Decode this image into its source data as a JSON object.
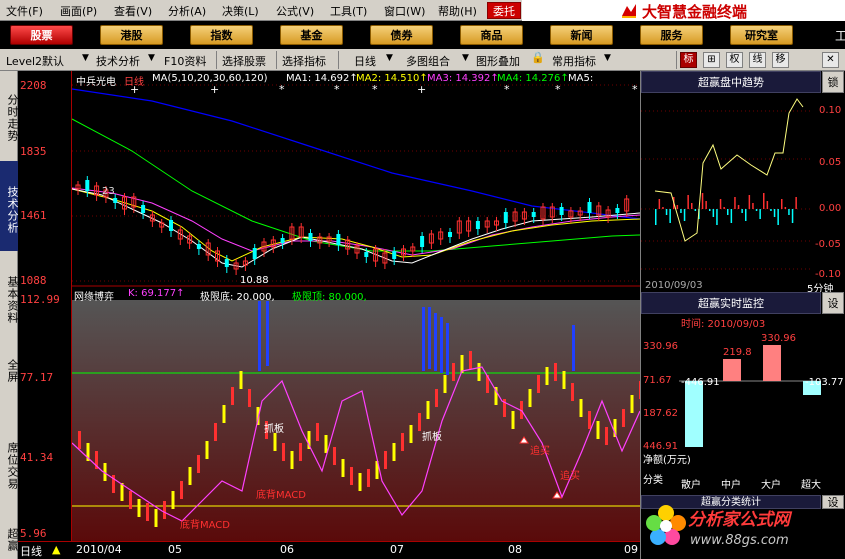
{
  "menu": {
    "items": [
      "文件(F)",
      "画面(P)",
      "查看(V)",
      "分析(A)",
      "决策(L)",
      "公式(V)",
      "工具(T)",
      "窗口(W)",
      "帮助(H)"
    ],
    "trade_btn": "委托",
    "brand": "大智慧金融终端"
  },
  "categories": [
    {
      "label": "股票",
      "active": true
    },
    {
      "label": "港股"
    },
    {
      "label": "指数"
    },
    {
      "label": "基金"
    },
    {
      "label": "债券"
    },
    {
      "label": "商品"
    },
    {
      "label": "新闻"
    },
    {
      "label": "服务"
    },
    {
      "label": "研究室"
    }
  ],
  "cat_extra": "工",
  "toolbar": {
    "level2": "Level2默认",
    "tech": "技术分析",
    "f10": "F10资料",
    "select_stock": "选择股票",
    "select_indicator": "选择指标",
    "period": "日线",
    "multi": "多图组合",
    "overlay": "图形叠加",
    "common": "常用指标",
    "squares": [
      "标",
      "⊞",
      "权",
      "线",
      "移",
      "✕"
    ]
  },
  "left_tabs": [
    "分时走势",
    "技术分析",
    "基本资料",
    "全屏",
    "席位交易",
    "超赢"
  ],
  "main_chart": {
    "stock_name": "中兵光电",
    "period": "日线",
    "ma_label": "MA(5,10,20,30,60,120)",
    "ma1": "MA1: 14.692↑",
    "ma2": "MA2: 14.510↑",
    "ma3": "MA3: 14.392↑",
    "ma4": "MA4: 14.276↑",
    "ma5": "MA5:",
    "y_labels": [
      "2208",
      "1835",
      "1461",
      "1088"
    ],
    "low_label": "10.88",
    "high_label": "23"
  },
  "indicator": {
    "name": "网缘博弈",
    "k": "K: 69.177↑",
    "low_limit": "极限底: 20.000,",
    "high_limit": "极限顶: 80.000,",
    "y_labels": [
      "112.99",
      "77.17",
      "41.34",
      "5.96"
    ],
    "annotations": [
      "抓板",
      "抓板",
      "底背MACD",
      "底背MACD",
      "追买",
      "追买"
    ]
  },
  "bottom": {
    "period": "日线",
    "x_labels": [
      "2010/04",
      "05",
      "06",
      "07",
      "08",
      "09"
    ]
  },
  "trend_panel": {
    "title": "超赢盘中趋势",
    "lock": "锁",
    "y_labels": [
      "0.10",
      "0.05",
      "0.00",
      "-0.05",
      "-0.10"
    ],
    "date": "2010/09/03",
    "minute": "5分钟"
  },
  "monitor_panel": {
    "title": "超赢实时监控",
    "settings": "设",
    "time": "时间: 2010/09/03",
    "left_labels": [
      "330.96",
      "71.67",
      "187.62",
      "446.91"
    ],
    "bar_values": [
      "-446.91",
      "219.8",
      "330.96",
      "-103.77"
    ],
    "net": "净额(万元)",
    "classify": "分类",
    "categories": [
      "散户",
      "中户",
      "大户",
      "超大"
    ],
    "bottom_title": "超赢分类统计",
    "bottom_btn": "设"
  },
  "watermark": {
    "text": "分析家公式网",
    "url": "www.88gs.com"
  },
  "colors": {
    "ma1": "#ffffff",
    "ma2": "#ffff00",
    "ma3": "#ff40ff",
    "ma4": "#00ff00",
    "ma5": "#0000ff",
    "up": "#ff3030",
    "down": "#00ffff",
    "indicator_line": "#ff40ff",
    "k_line": "#ffff00"
  }
}
